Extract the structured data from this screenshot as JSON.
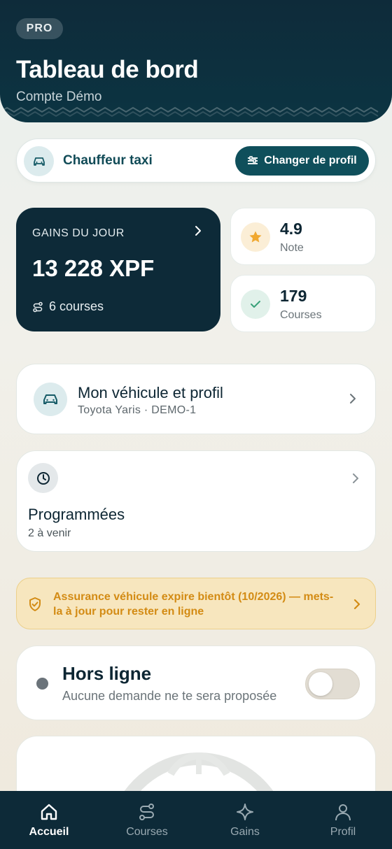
{
  "header": {
    "badge": "PRO",
    "title": "Tableau de bord",
    "subtitle": "Compte Démo"
  },
  "profile_bar": {
    "label": "Chauffeur taxi",
    "change_button": "Changer de profil"
  },
  "earnings": {
    "title": "GAINS DU JOUR",
    "amount": "13 228 XPF",
    "rides": "6 courses"
  },
  "stats": {
    "rating_value": "4.9",
    "rating_label": "Note",
    "rides_value": "179",
    "rides_label": "Courses"
  },
  "vehicle": {
    "title": "Mon véhicule et profil",
    "subtitle": "Toyota Yaris · DEMO-1"
  },
  "scheduled": {
    "title": "Programmées",
    "subtitle": "2 à venir"
  },
  "alert": {
    "text": "Assurance véhicule expire bientôt (10/2026) — mets-la à jour pour rester en ligne"
  },
  "status": {
    "title": "Hors ligne",
    "subtitle": "Aucune demande ne te sera proposée",
    "online": false
  },
  "nav": {
    "items": [
      {
        "label": "Accueil",
        "icon": "home-icon",
        "active": true
      },
      {
        "label": "Courses",
        "icon": "route-icon",
        "active": false
      },
      {
        "label": "Gains",
        "icon": "sparkle-icon",
        "active": false
      },
      {
        "label": "Profil",
        "icon": "user-icon",
        "active": false
      }
    ]
  },
  "colors": {
    "primary_dark": "#0d2a38",
    "accent_teal": "#0f4f5b",
    "warning": "#d38b14",
    "star": "#f0a830",
    "success": "#3aa17a"
  }
}
